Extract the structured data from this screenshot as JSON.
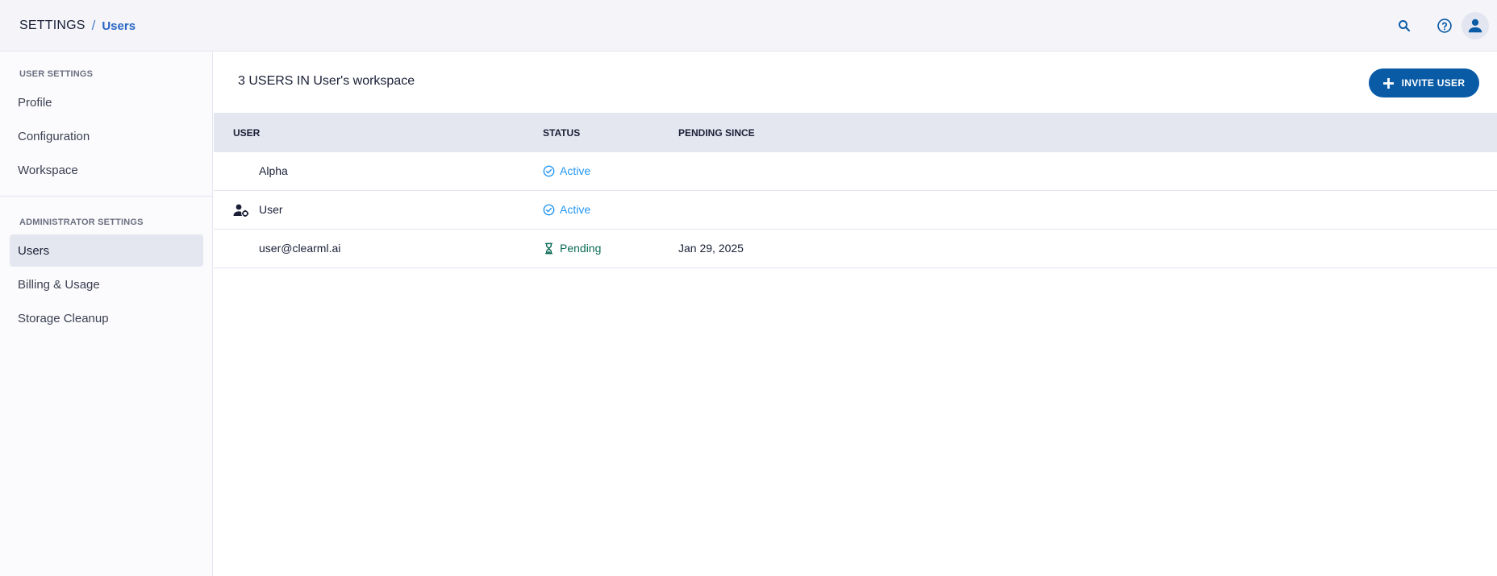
{
  "header": {
    "breadcrumb": {
      "root": "SETTINGS",
      "separator": "/",
      "current": "Users"
    },
    "icons": [
      "search-icon",
      "help-icon",
      "avatar-icon"
    ]
  },
  "sidebar": {
    "sections": [
      {
        "title": "USER SETTINGS",
        "items": [
          {
            "label": "Profile",
            "active": false
          },
          {
            "label": "Configuration",
            "active": false
          },
          {
            "label": "Workspace",
            "active": false
          }
        ]
      },
      {
        "title": "ADMINISTRATOR SETTINGS",
        "items": [
          {
            "label": "Users",
            "active": true
          },
          {
            "label": "Billing & Usage",
            "active": false
          },
          {
            "label": "Storage Cleanup",
            "active": false
          }
        ]
      }
    ]
  },
  "main": {
    "title": "3 USERS IN User's workspace",
    "invite_button": {
      "label": "INVITE USER",
      "icon": "plus-icon"
    },
    "table": {
      "columns": [
        "USER",
        "STATUS",
        "PENDING SINCE"
      ],
      "rows": [
        {
          "user": "Alpha",
          "user_icon": "",
          "status": "Active",
          "status_icon": "check-circle-icon",
          "pending_since": ""
        },
        {
          "user": "User",
          "user_icon": "admin-user-icon",
          "status": "Active",
          "status_icon": "check-circle-icon",
          "pending_since": ""
        },
        {
          "user": "user@clearml.ai",
          "user_icon": "",
          "status": "Pending",
          "status_icon": "hourglass-icon",
          "pending_since": "Jan 29, 2025"
        }
      ]
    }
  },
  "colors": {
    "primary": "#0a5ba6",
    "active_status": "#2196f3",
    "pending_status": "#0a6b55",
    "breadcrumb_current": "#2a66c3",
    "table_header_bg": "#e4e6f0",
    "sidebar_active_bg": "#e5e7f0"
  }
}
